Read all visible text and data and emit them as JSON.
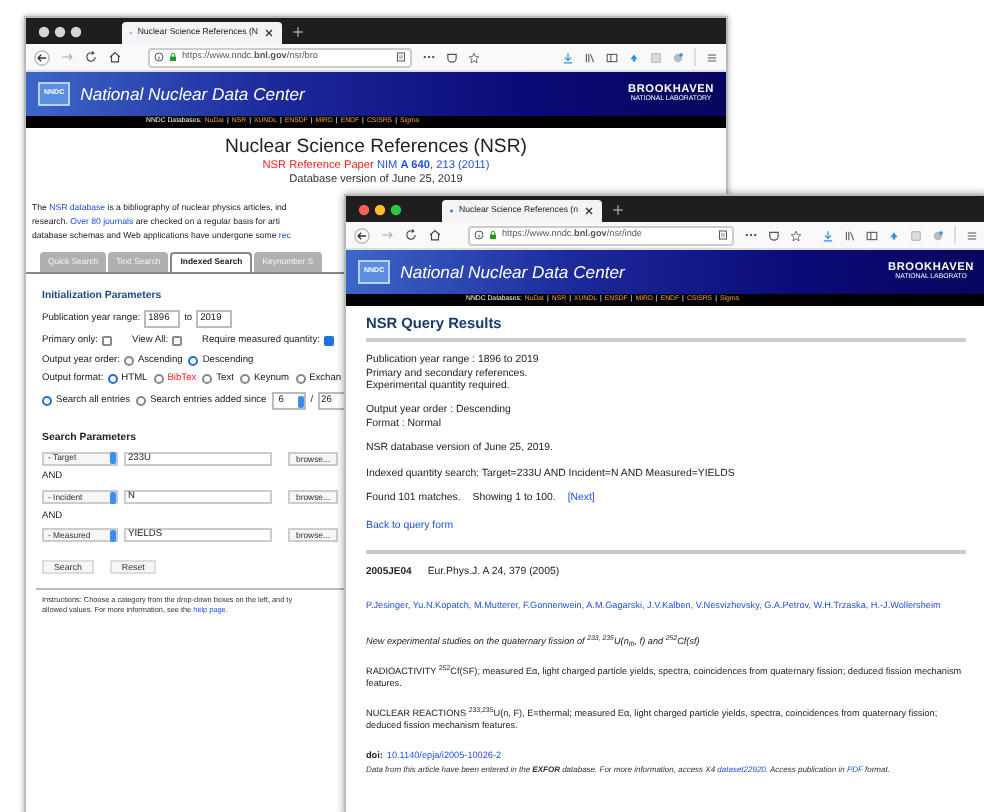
{
  "windows": [
    {
      "active": false,
      "tab_title": "Nuclear Science References (N",
      "url": "https://www.nndc.**bnl.gov**/nsr/bro",
      "banner": {
        "logo": "NNDC",
        "title": "National Nuclear Data Center",
        "lab": "BROOKHAVEN",
        "lab_sub": "NATIONAL LABORATORY"
      },
      "nav": {
        "label": "NNDC Databases:",
        "separator": "|",
        "links": [
          "NuDat",
          "NSR",
          "XUNDL",
          "ENSDF",
          "MIRD",
          "ENDF",
          "CSISRS",
          "Sigma"
        ]
      }
    },
    {
      "active": true,
      "tab_title": "Nuclear Science References (n",
      "url": "https://www.nndc.**bnl.gov**/nsr/inde",
      "banner": {
        "logo": "NNDC",
        "title": "National Nuclear Data Center",
        "lab": "BROOKHAVEN",
        "lab_sub": "NATIONAL LABORATO"
      },
      "nav": {
        "label": "NNDC Databases:",
        "separator": "|",
        "links": [
          "NuDat",
          "NSR",
          "XUNDL",
          "ENSDF",
          "MIRD",
          "ENDF",
          "CSISRS",
          "Sigma"
        ]
      }
    }
  ],
  "search_page": {
    "heading": "Nuclear Science References (NSR)",
    "subtitle": "NSR Reference Paper",
    "subtitle_link": "NIM **A 640**, 213 (2011)",
    "version": "Database version of June 25, 2019",
    "intro": [
      [
        {
          "text": "The "
        },
        {
          "text": "NSR database",
          "link": true
        },
        {
          "text": " is a bibliography of nuclear physics articles, ind"
        }
      ],
      [
        {
          "text": "research. "
        },
        {
          "text": "Over 80 journals",
          "link": true
        },
        {
          "text": " are checked on a regular basis for arti"
        }
      ],
      [
        {
          "text": "database schemas and Web applications have undergone some "
        },
        {
          "text": "rec",
          "link": true
        }
      ]
    ],
    "tabs": [
      {
        "label": "Quick Search",
        "selected": false
      },
      {
        "label": "Text Search",
        "selected": false
      },
      {
        "label": "Indexed Search",
        "selected": true
      },
      {
        "label": "Keynumber S",
        "selected": false
      }
    ],
    "init": {
      "title": "Initialization Parameters",
      "year_label": "Publication year range:",
      "year_from": "1896",
      "to_label": "to",
      "year_to": "2019",
      "checks": [
        {
          "label": "Primary only:",
          "checked": false
        },
        {
          "label": "View All:",
          "checked": false
        },
        {
          "label": "Require measured quantity:",
          "checked": true
        }
      ],
      "order": {
        "label": "Output year order:",
        "options": [
          {
            "label": "Ascending",
            "selected": false
          },
          {
            "label": "Descending",
            "selected": true
          }
        ]
      },
      "format": {
        "label": "Output format:",
        "options": [
          {
            "label": "HTML",
            "selected": true,
            "kind": "plain"
          },
          {
            "label": "BibTex",
            "selected": false,
            "kind": "highlight"
          },
          {
            "label": "Text",
            "selected": false,
            "kind": "plain"
          },
          {
            "label": "Keynum",
            "selected": false,
            "kind": "plain"
          },
          {
            "label": "Exchan",
            "selected": false,
            "kind": "plain"
          }
        ]
      },
      "entries": {
        "options": [
          {
            "label": "Search all entries",
            "selected": true
          },
          {
            "label": "Search entries added since",
            "selected": false
          }
        ],
        "month": "6",
        "slash": "/",
        "year": "26"
      }
    },
    "params": {
      "title": "Search Parameters",
      "rows": [
        {
          "category": "- Target",
          "value": "233U",
          "button": "browse..."
        },
        {
          "connector": "AND",
          "category": "- Incident",
          "value": "N",
          "button": "browse..."
        },
        {
          "connector": "AND",
          "category": "- Measured",
          "value": "YIELDS",
          "button": "browse..."
        }
      ]
    },
    "buttons": [
      "Search",
      "Reset"
    ],
    "instructions": [
      [
        {
          "text": "Instructions: Choose a category from the drop-down boxes on the left, and ty"
        }
      ],
      [
        {
          "text": "allowed values. For more information, see the "
        },
        {
          "text": "help page",
          "link": true
        },
        {
          "text": "."
        }
      ]
    ]
  },
  "results_page": {
    "heading": "NSR Query Results",
    "summary": [
      [
        "Publication year range : 1896 to 2019",
        "Primary and secondary references.",
        "Experimental quantity required."
      ],
      [
        "Output year order : Descending",
        "Format : Normal"
      ],
      [
        "NSR database version of June 25, 2019."
      ],
      [
        "Indexed quantity search: Target=233U AND Incident=N AND Measured=YIELDS"
      ]
    ],
    "found": "Found 101 matches.",
    "showing": "Showing 1 to 100.",
    "next": "[Next]",
    "back_link": "Back to query form",
    "entry": {
      "key": "2005JE04",
      "citation": "Eur.Phys.J. A 24, 379 (2005)",
      "authors": "P.Jesinger, Yu.N.Kopatch, M.Mutterer, F.Gonnenwein, A.M.Gagarski, J.V.Kalben, V.Nesvizhevsky, G.A.Petrov, W.H.Trzaska, H.-J.Wollersheim",
      "title": "New experimental studies on the quaternary fission of $^{233, 235}$U(n$_{th}$, f) and $^{252}$Cf(sf)",
      "keywords": [
        "RADIOACTIVITY $^{252}$Cf(SF); measured Eα, light charged particle yields, spectra, coincidences from quaternary fission; deduced fission mechanism features.",
        "NUCLEAR REACTIONS $^{233,235}$U(n, F), E=thermal; measured Eα, light charged particle yields, spectra, coincidences from quaternary fission; deduced fission mechanism features."
      ],
      "doi_label": "doi:",
      "doi": "10.1140/epja/i2005-10026-2",
      "note": [
        {
          "text": "Data from this article have been entered in the **EXFOR** database. For more information, access X4 "
        },
        {
          "text": "dataset22920",
          "link": true
        },
        {
          "text": ". Access publication in "
        },
        {
          "text": "PDF",
          "link": true
        },
        {
          "text": " format."
        }
      ]
    }
  }
}
